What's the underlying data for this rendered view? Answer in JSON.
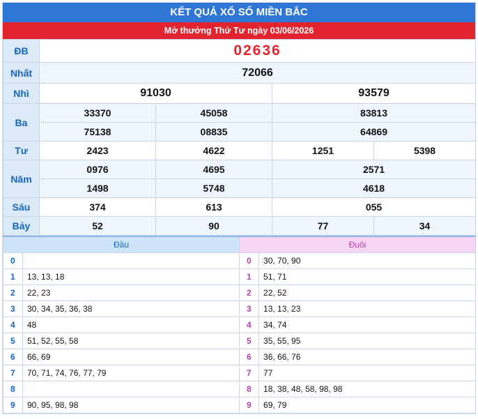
{
  "title": "KẾT QUẢ XỔ SỐ MIỀN BẮC",
  "subtitle": "Mở thưởng Thứ Tư ngày 03/06/2026",
  "prizes": {
    "db": {
      "label": "ĐB",
      "values": [
        "02636"
      ]
    },
    "nhat": {
      "label": "Nhất",
      "values": [
        "72066"
      ]
    },
    "nhi": {
      "label": "Nhì",
      "values": [
        "91030",
        "93579"
      ]
    },
    "ba": {
      "label": "Ba",
      "values": [
        "33370",
        "45058",
        "83813",
        "75138",
        "08835",
        "64869"
      ]
    },
    "tu": {
      "label": "Tư",
      "values": [
        "2423",
        "4622",
        "1251",
        "5398"
      ]
    },
    "nam": {
      "label": "Năm",
      "values": [
        "0976",
        "4695",
        "2571",
        "1498",
        "5748",
        "4618"
      ]
    },
    "sau": {
      "label": "Sáu",
      "values": [
        "374",
        "613",
        "055"
      ]
    },
    "bay": {
      "label": "Bảy",
      "values": [
        "52",
        "90",
        "77",
        "34"
      ]
    }
  },
  "loto": {
    "dau_header": "Đầu",
    "duoi_header": "Đuôi",
    "rows": [
      {
        "dau_key": "0",
        "dau": "",
        "duoi_key": "0",
        "duoi": "30, 70, 90"
      },
      {
        "dau_key": "1",
        "dau": "13, 13, 18",
        "duoi_key": "1",
        "duoi": "51, 71"
      },
      {
        "dau_key": "2",
        "dau": "22, 23",
        "duoi_key": "2",
        "duoi": "22, 52"
      },
      {
        "dau_key": "3",
        "dau": "30, 34, 35, 36, 38",
        "duoi_key": "3",
        "duoi": "13, 13, 23"
      },
      {
        "dau_key": "4",
        "dau": "48",
        "duoi_key": "4",
        "duoi": "34, 74"
      },
      {
        "dau_key": "5",
        "dau": "51, 52, 55, 58",
        "duoi_key": "5",
        "duoi": "35, 55, 95"
      },
      {
        "dau_key": "6",
        "dau": "66, 69",
        "duoi_key": "6",
        "duoi": "36, 66, 76"
      },
      {
        "dau_key": "7",
        "dau": "70, 71, 74, 76, 77, 79",
        "duoi_key": "7",
        "duoi": "77"
      },
      {
        "dau_key": "8",
        "dau": "",
        "duoi_key": "8",
        "duoi": "18, 38, 48, 58, 98, 98"
      },
      {
        "dau_key": "9",
        "dau": "90, 95, 98, 98",
        "duoi_key": "9",
        "duoi": "69, 79"
      }
    ]
  }
}
